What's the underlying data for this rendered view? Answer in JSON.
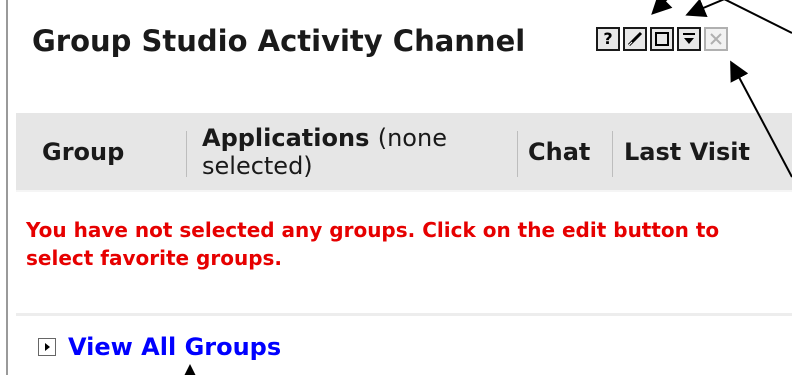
{
  "portlet": {
    "title": "Group Studio Activity Channel"
  },
  "toolbar": {
    "help_label": "?",
    "buttons": [
      "help-icon",
      "edit-icon",
      "maximize-icon",
      "minimize-icon",
      "close-icon"
    ]
  },
  "table": {
    "columns": [
      {
        "label": "Group",
        "note": ""
      },
      {
        "label": "Applications",
        "note": "(none selected)"
      },
      {
        "label": "Chat",
        "note": ""
      },
      {
        "label": "Last Visit",
        "note": ""
      }
    ]
  },
  "message": {
    "text": "You have not selected any groups. Click on the edit button to select favorite groups.",
    "color": "#e60000"
  },
  "footer": {
    "link_label": "View All Groups",
    "link_color": "#0000ff"
  }
}
